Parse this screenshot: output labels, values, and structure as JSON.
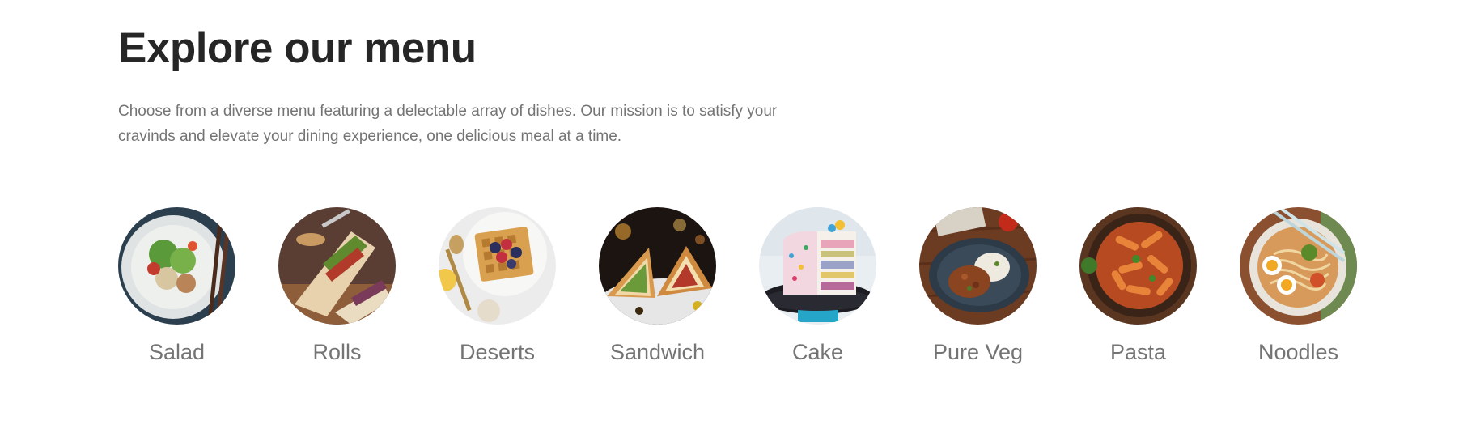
{
  "section": {
    "title": "Explore our menu",
    "description": "Choose from a diverse menu featuring a delectable array of dishes. Our mission is to satisfy your cravinds and elevate your dining experience, one delicious meal at a time."
  },
  "menu": {
    "items": [
      {
        "label": "Salad",
        "icon": "salad-bowl-image"
      },
      {
        "label": "Rolls",
        "icon": "wrap-rolls-image"
      },
      {
        "label": "Deserts",
        "icon": "waffle-dessert-image"
      },
      {
        "label": "Sandwich",
        "icon": "sandwich-image"
      },
      {
        "label": "Cake",
        "icon": "layered-cake-image"
      },
      {
        "label": "Pure Veg",
        "icon": "veg-curry-rice-image"
      },
      {
        "label": "Pasta",
        "icon": "penne-pasta-image"
      },
      {
        "label": "Noodles",
        "icon": "ramen-noodles-image"
      }
    ]
  },
  "colors": {
    "heading": "#262626",
    "body_text": "#747474",
    "background": "#ffffff"
  }
}
